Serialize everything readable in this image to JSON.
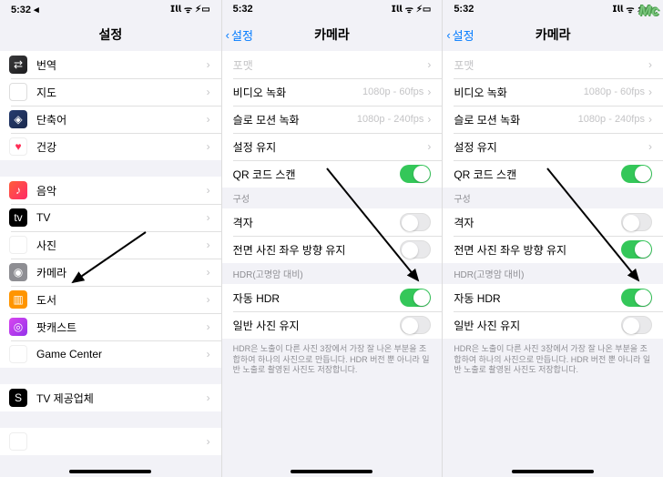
{
  "status": {
    "time": "5:32",
    "time_arrow": "5:32 ◂",
    "signal": "▪▪▪▪",
    "wifi": "⌔",
    "battery": "▭"
  },
  "watermark": "Mc",
  "panel1": {
    "title": "설정",
    "group1": [
      {
        "icon": "ic-translate",
        "glyph": "⇄",
        "label": "번역"
      },
      {
        "icon": "ic-maps",
        "glyph": "➤",
        "label": "지도"
      },
      {
        "icon": "ic-shortcuts",
        "glyph": "◈",
        "label": "단축어"
      },
      {
        "icon": "ic-health",
        "glyph": "♥",
        "label": "건강"
      }
    ],
    "group2": [
      {
        "icon": "ic-music",
        "glyph": "♪",
        "label": "음악"
      },
      {
        "icon": "ic-tv",
        "glyph": "tv",
        "label": "TV"
      },
      {
        "icon": "ic-photos",
        "glyph": "✿",
        "label": "사진"
      },
      {
        "icon": "ic-camera",
        "glyph": "◉",
        "label": "카메라"
      },
      {
        "icon": "ic-books",
        "glyph": "▥",
        "label": "도서"
      },
      {
        "icon": "ic-podcasts",
        "glyph": "◎",
        "label": "팟캐스트"
      },
      {
        "icon": "ic-gamecenter",
        "glyph": "◉",
        "label": "Game Center"
      }
    ],
    "group3": [
      {
        "icon": "ic-provider",
        "glyph": "S",
        "label": "TV 제공업체"
      }
    ],
    "group4": [
      {
        "icon": "ic-unknown",
        "glyph": "○",
        "label": ""
      }
    ]
  },
  "camera": {
    "back_label": "설정",
    "title": "카메라",
    "rows": {
      "format": {
        "label": "포맷"
      },
      "video": {
        "label": "비디오 녹화",
        "detail": "1080p - 60fps"
      },
      "slomo": {
        "label": "슬로 모션 녹화",
        "detail": "1080p - 240fps"
      },
      "preserve": {
        "label": "설정 유지"
      },
      "qr": {
        "label": "QR 코드 스캔"
      }
    },
    "composition_header": "구성",
    "composition": {
      "grid": {
        "label": "격자"
      },
      "mirror": {
        "label": "전면 사진 좌우 방향 유지"
      }
    },
    "hdr_header": "HDR(고명암 대비)",
    "hdr": {
      "auto": {
        "label": "자동 HDR"
      },
      "keep": {
        "label": "일반 사진 유지"
      }
    },
    "hdr_footer": "HDR은 노출이 다른 사진 3장에서 가장 잘 나온 부분을 조합하여 하나의 사진으로 만듭니다. HDR 버전 뿐 아니라 일반 노출로 촬영된 사진도 저장합니다."
  },
  "panel2_toggle": {
    "qr": true,
    "grid": false,
    "mirror": false,
    "auto_hdr": true,
    "keep": false
  },
  "panel3_toggle": {
    "qr": true,
    "grid": false,
    "mirror": true,
    "auto_hdr": true,
    "keep": false
  }
}
